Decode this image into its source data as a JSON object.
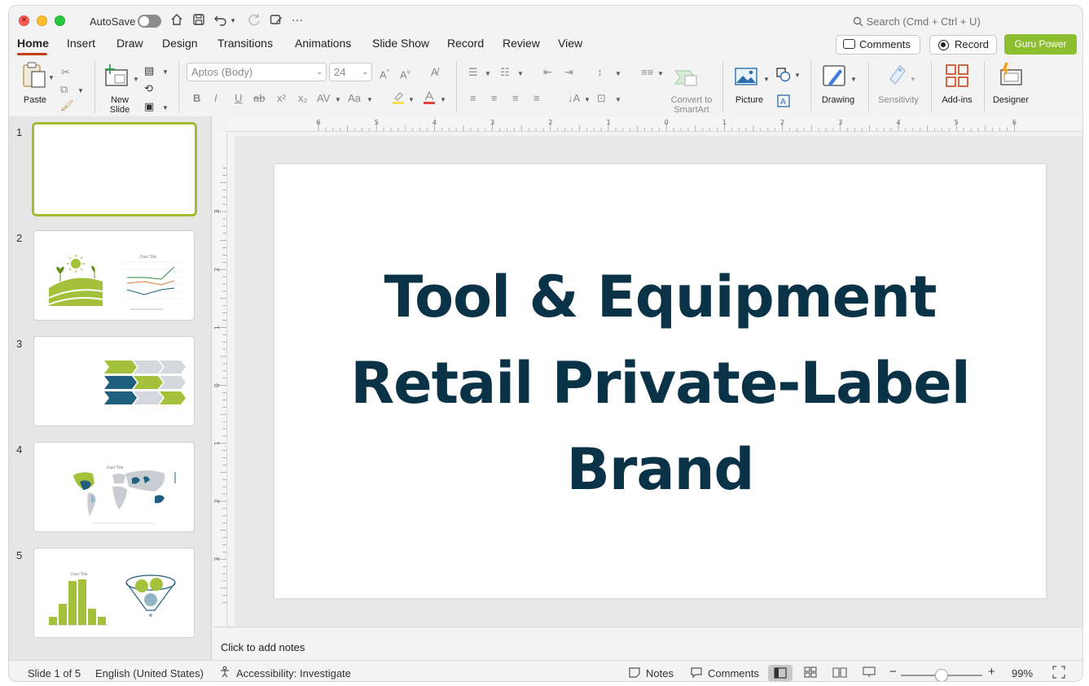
{
  "titlebar": {
    "autosave_label": "AutoSave",
    "search_placeholder": "Search (Cmd + Ctrl + U)"
  },
  "menu": {
    "tabs": [
      "Home",
      "Insert",
      "Draw",
      "Design",
      "Transitions",
      "Animations",
      "Slide Show",
      "Record",
      "Review",
      "View"
    ],
    "active": "Home",
    "comments_label": "Comments",
    "record_label": "Record",
    "guru_label": "Guru Power"
  },
  "ribbon": {
    "paste_label": "Paste",
    "new_slide_label": "New\nSlide",
    "font_name": "Aptos (Body)",
    "font_size": "24",
    "convert_label": "Convert to\nSmartArt",
    "picture_label": "Picture",
    "drawing_label": "Drawing",
    "sensitivity_label": "Sensitivity",
    "addins_label": "Add-ins",
    "designer_label": "Designer"
  },
  "thumbnails": [
    {
      "number": "1",
      "selected": true
    },
    {
      "number": "2",
      "chart_title": "Chart Title"
    },
    {
      "number": "3"
    },
    {
      "number": "4",
      "chart_title": "Chart Title"
    },
    {
      "number": "5",
      "chart_title": "Chart Title"
    }
  ],
  "ruler": {
    "h_ticks": [
      "6",
      "5",
      "4",
      "3",
      "2",
      "1",
      "0",
      "1",
      "2",
      "3",
      "4",
      "5",
      "6"
    ],
    "v_ticks": [
      "3",
      "2",
      "1",
      "0",
      "1",
      "2",
      "3"
    ]
  },
  "slide": {
    "title_lines": [
      "Tool & Equipment",
      "Retail Private-Label",
      "Brand"
    ]
  },
  "notes_placeholder": "Click to add notes",
  "status": {
    "slide_indicator": "Slide 1 of 5",
    "language": "English (United States)",
    "accessibility": "Accessibility: Investigate",
    "notes_label": "Notes",
    "comments_label": "Comments",
    "zoom": "99%"
  },
  "colors": {
    "accent": "#c43e1c",
    "guru": "#8cbf2e",
    "title_text": "#0b3348",
    "lime": "#a3c13a",
    "teal": "#1f5f7f"
  }
}
